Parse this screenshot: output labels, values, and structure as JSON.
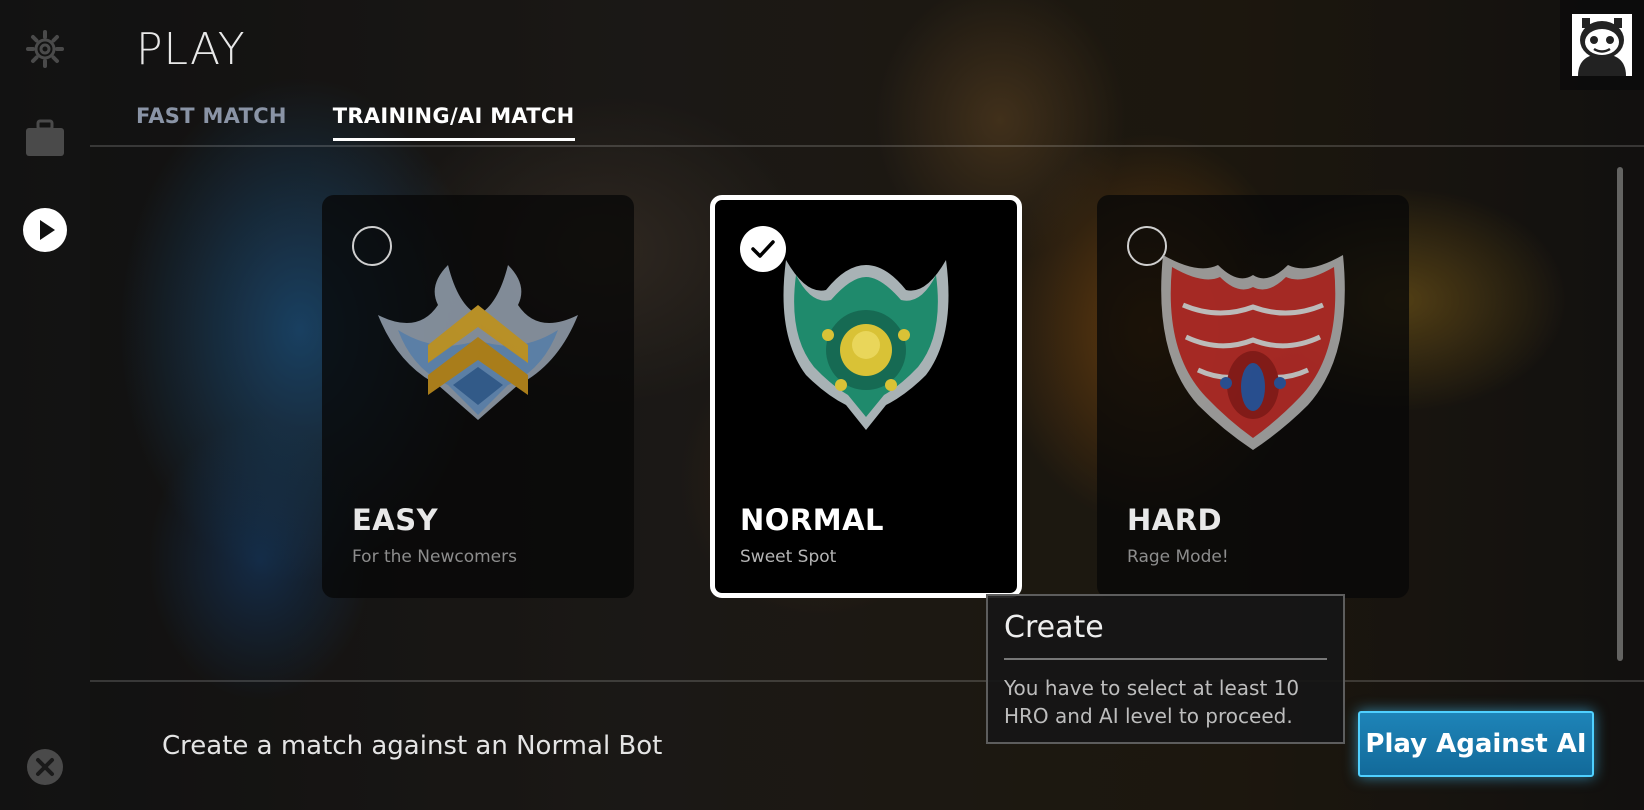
{
  "header": {
    "title": "PLAY",
    "tabs": [
      {
        "label": "FAST MATCH",
        "active": false
      },
      {
        "label": "TRAINING/AI MATCH",
        "active": true
      }
    ]
  },
  "sidebar": {
    "items": [
      {
        "icon": "gear-icon"
      },
      {
        "icon": "briefcase-icon"
      },
      {
        "icon": "play-icon",
        "active": true
      }
    ],
    "close_icon": "close-icon"
  },
  "difficulty_cards": [
    {
      "title": "EASY",
      "subtitle": "For the Newcomers",
      "selected": false,
      "emblem": "easy-wings-emblem",
      "colors": [
        "#e3b12e",
        "#5d8fc4",
        "#c7d3e0"
      ]
    },
    {
      "title": "NORMAL",
      "subtitle": "Sweet Spot",
      "selected": true,
      "emblem": "normal-shield-emblem",
      "colors": [
        "#1f8a6c",
        "#d9c236",
        "#a7b0b3"
      ]
    },
    {
      "title": "HARD",
      "subtitle": "Rage Mode!",
      "selected": false,
      "emblem": "hard-crest-emblem",
      "colors": [
        "#c9302b",
        "#2f5fb0",
        "#b9b9b9"
      ]
    }
  ],
  "tooltip": {
    "title": "Create",
    "body": "You have to select at least 10 HRO and AI level  to proceed."
  },
  "footer": {
    "description": "Create a match against an Normal Bot",
    "play_button": "Play Against AI"
  },
  "colors": {
    "accent": "#1e84b8",
    "accent_glow": "#4fd0ff"
  }
}
